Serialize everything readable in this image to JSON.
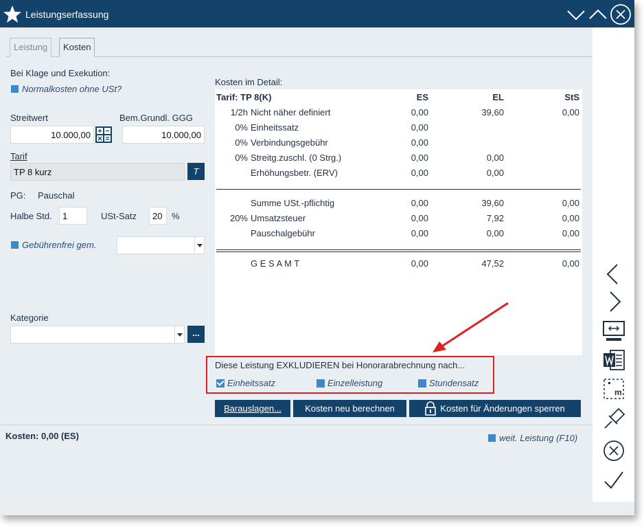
{
  "window": {
    "title": "Leistungserfassung"
  },
  "tabs": [
    {
      "label": "Leistung"
    },
    {
      "label": "Kosten"
    }
  ],
  "left": {
    "klage_label": "Bei Klage und Exekution:",
    "normalkosten_label": "Normalkosten ohne USt?",
    "streitwert_label": "Streitwert",
    "streitwert_value": "10.000,00",
    "bemgrundl_label": "Bem.Grundl. GGG",
    "bemgrundl_value": "10.000,00",
    "tarif_label": "Tarif",
    "tarif_value": "TP 8 kurz",
    "tarif_button": "T",
    "pg_label": "PG:",
    "pg_value": "Pauschal",
    "halbe_label": "Halbe Std.",
    "halbe_value": "1",
    "ust_label": "USt-Satz",
    "ust_value": "20",
    "ust_unit": "%",
    "gebuehrenfrei_label": "Gebührenfrei gem.",
    "kategorie_label": "Kategorie",
    "kategorie_button": "..."
  },
  "detail": {
    "heading": "Kosten im Detail:",
    "tarif_header": "Tarif: TP 8(K)",
    "col_es": "ES",
    "col_el": "EL",
    "col_sts": "StS",
    "rows": [
      {
        "pct": "1/2h",
        "label": "Nicht näher definiert",
        "es": "0,00",
        "el": "39,60",
        "sts": "0,00"
      },
      {
        "pct": "0%",
        "label": "Einheitssatz",
        "es": "0,00",
        "el": "",
        "sts": ""
      },
      {
        "pct": "0%",
        "label": "Verbindungsgebühr",
        "es": "0,00",
        "el": "",
        "sts": ""
      },
      {
        "pct": "0%",
        "label": "Streitg.zuschl. (0 Strg.)",
        "es": "0,00",
        "el": "0,00",
        "sts": ""
      },
      {
        "pct": "",
        "label": "Erhöhungsbetr. (ERV)",
        "es": "0,00",
        "el": "0,00",
        "sts": ""
      }
    ],
    "summary": [
      {
        "pct": "",
        "label": "Summe USt.-pflichtig",
        "es": "0,00",
        "el": "39,60",
        "sts": "0,00"
      },
      {
        "pct": "20%",
        "label": "Umsatzsteuer",
        "es": "0,00",
        "el": "7,92",
        "sts": "0,00"
      },
      {
        "pct": "",
        "label": "Pauschalgebühr",
        "es": "0,00",
        "el": "0,00",
        "sts": "0,00"
      }
    ],
    "total": {
      "label": "G E S A M T",
      "es": "0,00",
      "el": "47,52",
      "sts": "0,00"
    }
  },
  "exclude": {
    "text": "Diese Leistung EXKLUDIEREN bei Honorarabrechnung nach...",
    "options": [
      {
        "label": "Einheitssatz",
        "checked": true
      },
      {
        "label": "Einzelleistung",
        "checked": false
      },
      {
        "label": "Stundensatz",
        "checked": false
      }
    ]
  },
  "buttons": {
    "barauslagen": "Barauslagen...",
    "neu_berechnen": "Kosten neu berechnen",
    "sperren": "Kosten für Änderungen sperren"
  },
  "footer": {
    "kosten": "Kosten: 0,00 (ES)",
    "weit": "weit. Leistung (F10)"
  },
  "colors": {
    "titlebar": "#13426b",
    "accent": "#3f88c5",
    "annotation": "#e01f1f"
  }
}
